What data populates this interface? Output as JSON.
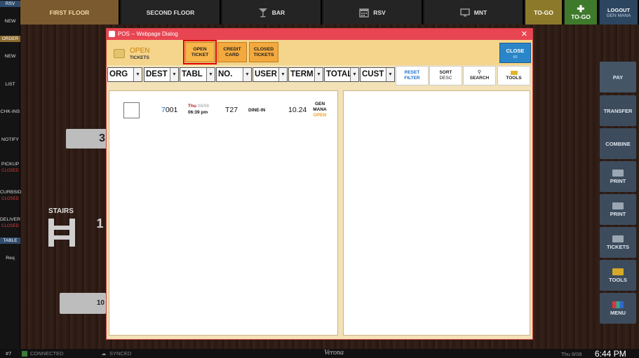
{
  "topbar": {
    "first_floor": "FIRST FLOOR",
    "second_floor": "SECOND FLOOR",
    "bar": "BAR",
    "rsv": "RSV",
    "mnt": "MNT",
    "togo": "TO-GO",
    "togo_add": "TO-GO",
    "logout": "LOGOUT",
    "logout_user": "GEN MANA"
  },
  "leftbar": {
    "rsv_tag": "RSV",
    "new1": "NEW",
    "order_tag": "ORDER",
    "new2": "NEW",
    "list": "LIST",
    "chkins": "CHK-INS",
    "notify": "NOTIFY",
    "pickup": "PICKUP",
    "pickup_status": "CLOSED",
    "curbside": "CURBSID",
    "curbside_status": "CLOSED",
    "delivery": "DELIVER",
    "delivery_status": "CLOSED",
    "table_tag": "TABLE",
    "req": "Req"
  },
  "floor": {
    "tile1": "3",
    "tile2": "1",
    "tile3": "10",
    "stairs": "STAIRS"
  },
  "rightbar": {
    "pay": "PAY",
    "transfer": "TRANSFER",
    "combine": "COMBINE",
    "print1": "PRINT",
    "print2": "PRINT",
    "tickets": "TICKETS",
    "tools": "TOOLS",
    "menu": "MENU"
  },
  "statusbar": {
    "terminal": "#7",
    "connected": "CONNECTED",
    "synced": "SYNCED",
    "location": "Verona",
    "date": "Thu 8/08",
    "time": "6:44 PM"
  },
  "dialog": {
    "title": "POS -- Webpage Dialog",
    "close_x": "✕",
    "open_label": "OPEN",
    "open_sub": "TICKETS",
    "btn_open": [
      "OPEN",
      "TICKET"
    ],
    "btn_credit": [
      "CREDIT",
      "CARD"
    ],
    "btn_closed": [
      "CLOSED",
      "TICKETS"
    ],
    "close_label": "CLOSE",
    "close_count": "60",
    "filters": [
      "ORG",
      "DEST",
      "TABL",
      "NO.",
      "USER",
      "TERM",
      "TOTAL",
      "CUST"
    ],
    "reset_filter": [
      "RESET",
      "FILTER"
    ],
    "sort_desc": [
      "SORT",
      "DESC"
    ],
    "search": "SEARCH",
    "tools": "TOOLS"
  },
  "ticket": {
    "id_prefix": "7",
    "id_rest": "001",
    "day": "Thu",
    "date": "08/08",
    "time": "06:39 pm",
    "table": "T27",
    "type": "DINE-IN",
    "amount": "10.24",
    "user": "GEN MANA",
    "status": "OPEN"
  }
}
